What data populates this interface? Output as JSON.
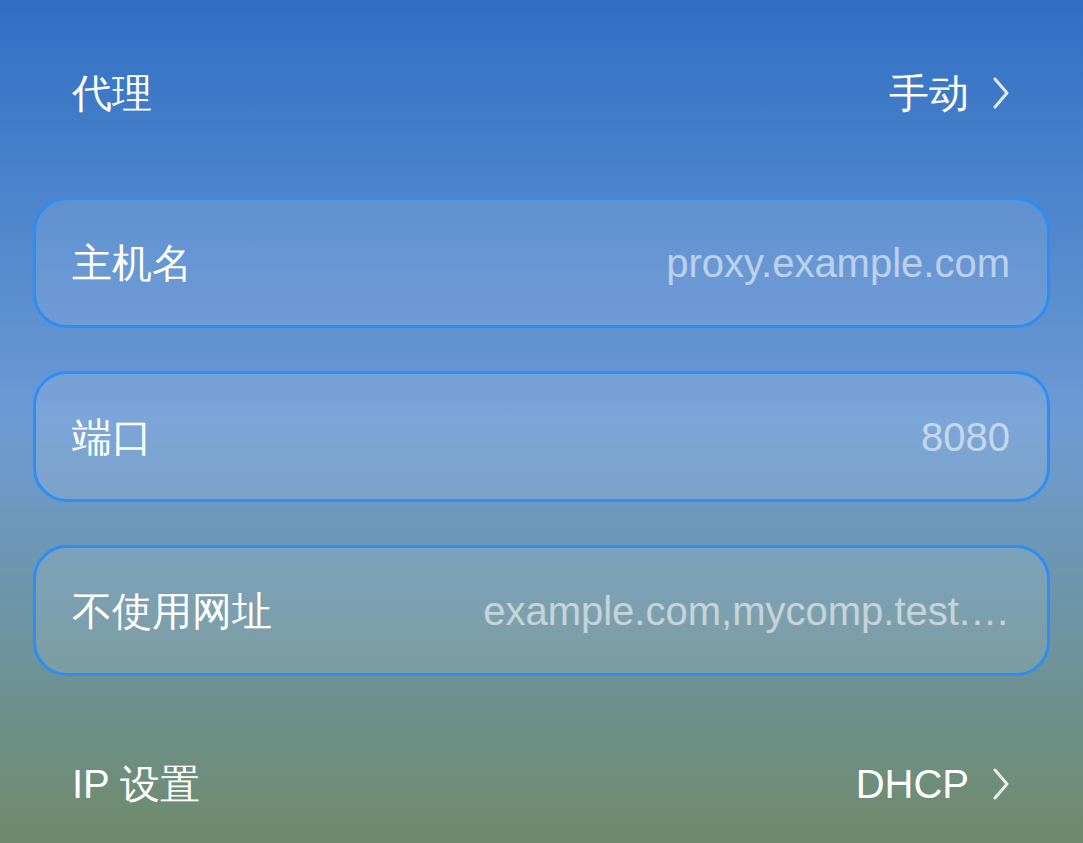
{
  "proxy": {
    "label": "代理",
    "value": "手动"
  },
  "fields": [
    {
      "label": "主机名",
      "placeholder": "proxy.example.com"
    },
    {
      "label": "端口",
      "placeholder": "8080"
    },
    {
      "label": "不使用网址",
      "placeholder": "example.com,mycomp.test.…"
    }
  ],
  "ip_settings": {
    "label": "IP 设置",
    "value": "DHCP"
  }
}
